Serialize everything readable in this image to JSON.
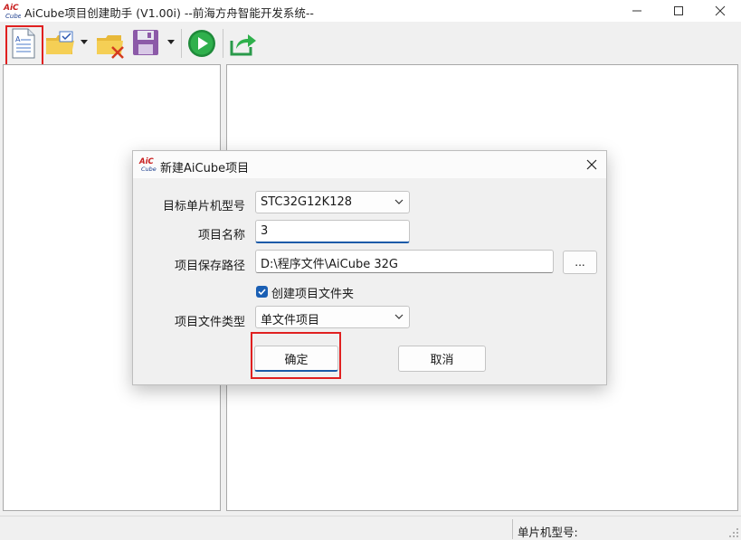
{
  "window": {
    "title": "AiCube项目创建助手 (V1.00i) --前海方舟智能开发系统--",
    "logo_text_top": "AiC",
    "logo_text_bottom": "Cube"
  },
  "toolbar": {
    "items": [
      "new-project",
      "open-project",
      "close-project",
      "save-project",
      "run",
      "export"
    ]
  },
  "statusbar": {
    "mcu_label": "单片机型号:"
  },
  "dialog": {
    "title": "新建AiCube项目",
    "fields": {
      "mcu_label": "目标单片机型号",
      "mcu_value": "STC32G12K128",
      "name_label": "项目名称",
      "name_value": "3",
      "path_label": "项目保存路径",
      "path_value": "D:\\程序文件\\AiCube  32G",
      "browse_label": "...",
      "create_folder_label": "创建项目文件夹",
      "create_folder_checked": true,
      "type_label": "项目文件类型",
      "type_value": "单文件项目"
    },
    "ok_label": "确定",
    "cancel_label": "取消"
  },
  "colors": {
    "accent": "#1a5aa8",
    "highlight": "#e02020",
    "run_green": "#2ea043"
  }
}
